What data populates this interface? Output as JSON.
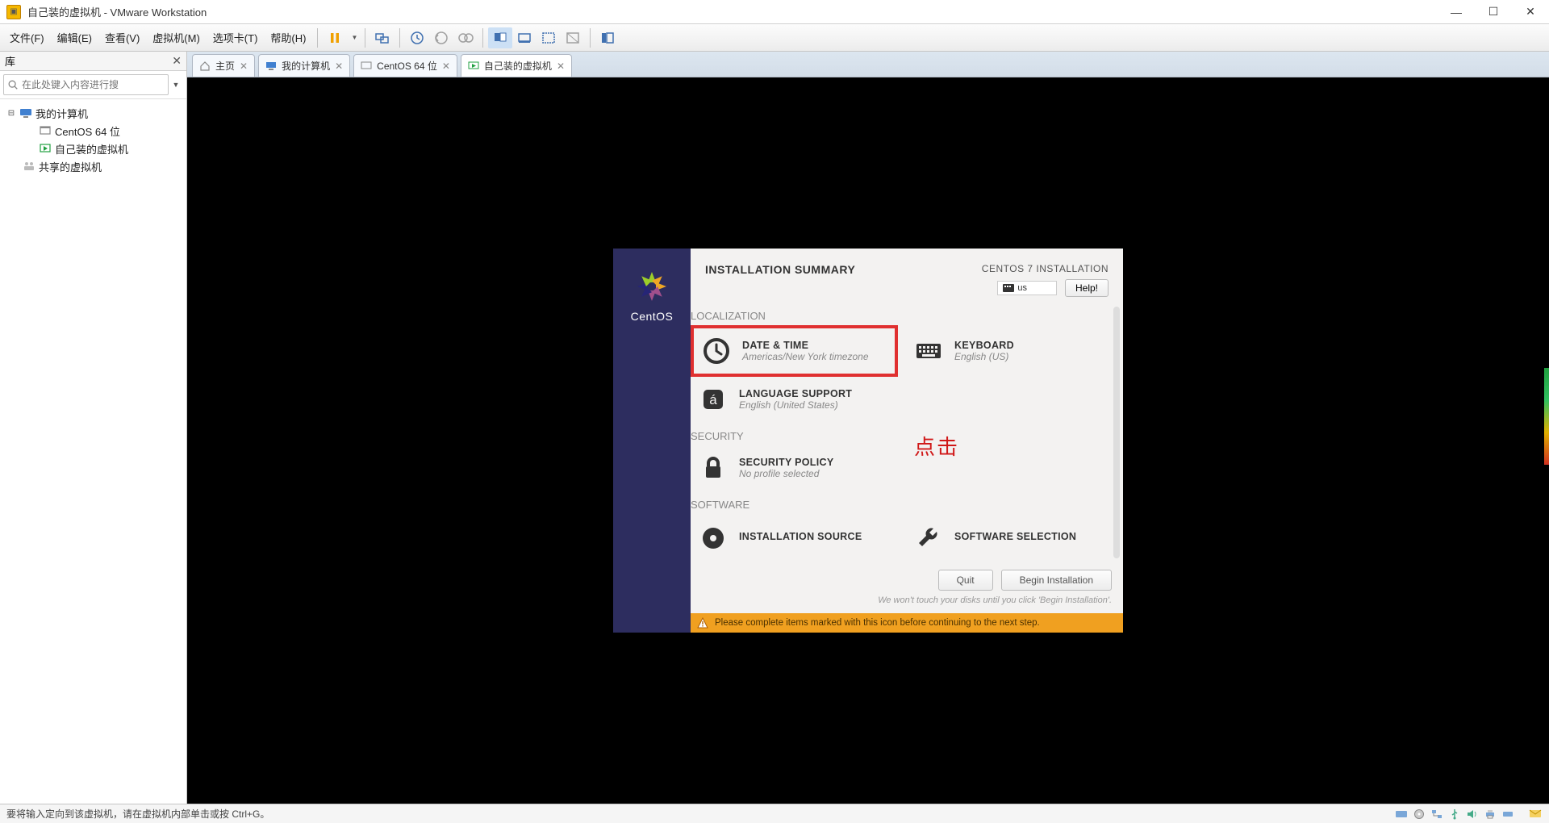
{
  "window": {
    "title": "自己装的虚拟机 - VMware Workstation"
  },
  "menus": {
    "file": "文件(F)",
    "edit": "编辑(E)",
    "view": "查看(V)",
    "vm": "虚拟机(M)",
    "tabs": "选项卡(T)",
    "help": "帮助(H)"
  },
  "library": {
    "title": "库",
    "search_placeholder": "在此处键入内容进行搜",
    "nodes": {
      "my_computer": "我的计算机",
      "centos64": "CentOS 64 位",
      "my_vm": "自己装的虚拟机",
      "shared": "共享的虚拟机"
    }
  },
  "tabs": {
    "home": "主页",
    "my_computer": "我的计算机",
    "centos64": "CentOS 64 位",
    "my_vm": "自己装的虚拟机"
  },
  "installer": {
    "brand": "CentOS",
    "title": "INSTALLATION SUMMARY",
    "product": "CENTOS 7 INSTALLATION",
    "kb_layout": "us",
    "help": "Help!",
    "sections": {
      "localization": "LOCALIZATION",
      "security": "SECURITY",
      "software": "SOFTWARE"
    },
    "spokes": {
      "datetime": {
        "title": "DATE & TIME",
        "sub": "Americas/New York timezone"
      },
      "keyboard": {
        "title": "KEYBOARD",
        "sub": "English (US)"
      },
      "language": {
        "title": "LANGUAGE SUPPORT",
        "sub": "English (United States)"
      },
      "secpolicy": {
        "title": "SECURITY POLICY",
        "sub": "No profile selected"
      },
      "instsource": {
        "title": "INSTALLATION SOURCE",
        "sub": ""
      },
      "swsel": {
        "title": "SOFTWARE SELECTION",
        "sub": ""
      }
    },
    "annotation": "点击",
    "buttons": {
      "quit": "Quit",
      "begin": "Begin Installation"
    },
    "hint": "We won't touch your disks until you click 'Begin Installation'.",
    "warning": "Please complete items marked with this icon before continuing to the next step."
  },
  "statusbar": {
    "text": "要将输入定向到该虚拟机，请在虚拟机内部单击或按 Ctrl+G。"
  }
}
